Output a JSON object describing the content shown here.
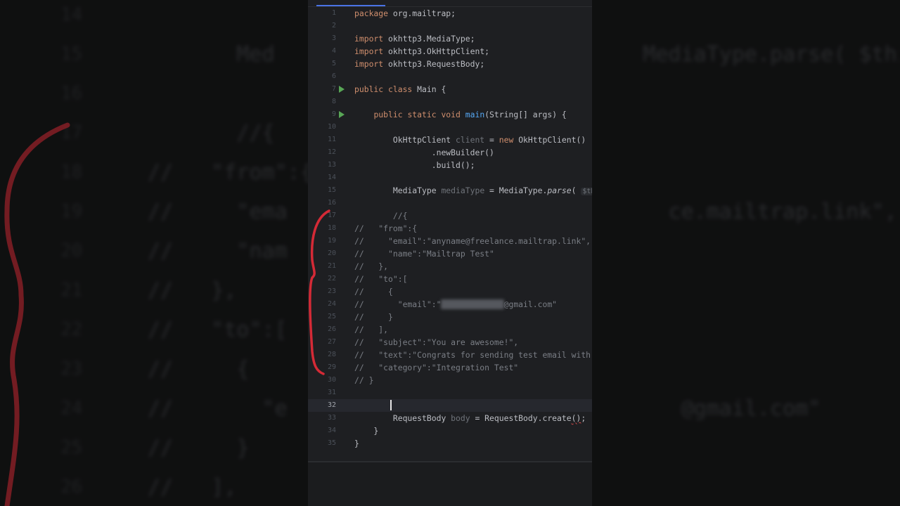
{
  "colors": {
    "background": "#1e1f22",
    "keyword": "#cf8e6d",
    "function": "#56a8f5",
    "comment": "#7a7e85",
    "run_marker": "#58a656",
    "annotation_red": "#d42a36"
  },
  "editor": {
    "lines": [
      {
        "num": "1",
        "segs": [
          {
            "t": "package ",
            "c": "kw"
          },
          {
            "t": "org.mailtrap;"
          }
        ]
      },
      {
        "num": "2",
        "segs": []
      },
      {
        "num": "3",
        "segs": [
          {
            "t": "import ",
            "c": "kw"
          },
          {
            "t": "okhttp3.MediaType;"
          }
        ]
      },
      {
        "num": "4",
        "segs": [
          {
            "t": "import ",
            "c": "kw"
          },
          {
            "t": "okhttp3.OkHttpClient;"
          }
        ]
      },
      {
        "num": "5",
        "segs": [
          {
            "t": "import ",
            "c": "kw"
          },
          {
            "t": "okhttp3.RequestBody;"
          }
        ]
      },
      {
        "num": "6",
        "segs": []
      },
      {
        "num": "7",
        "run": true,
        "segs": [
          {
            "t": "public class ",
            "c": "kw"
          },
          {
            "t": "Main {"
          }
        ]
      },
      {
        "num": "8",
        "segs": []
      },
      {
        "num": "9",
        "run": true,
        "segs": [
          {
            "t": "    "
          },
          {
            "t": "public static void ",
            "c": "kw"
          },
          {
            "t": "main",
            "c": "fn"
          },
          {
            "t": "(String[] args) {"
          }
        ]
      },
      {
        "num": "10",
        "segs": []
      },
      {
        "num": "11",
        "segs": [
          {
            "t": "        OkHttpClient "
          },
          {
            "t": "client",
            "c": "hint"
          },
          {
            "t": " = "
          },
          {
            "t": "new ",
            "c": "kw"
          },
          {
            "t": "OkHttpClient()"
          }
        ]
      },
      {
        "num": "12",
        "segs": [
          {
            "t": "                .newBuilder()"
          }
        ]
      },
      {
        "num": "13",
        "segs": [
          {
            "t": "                .build();"
          }
        ]
      },
      {
        "num": "14",
        "segs": []
      },
      {
        "num": "15",
        "segs": [
          {
            "t": "        MediaType "
          },
          {
            "t": "mediaType",
            "c": "hint"
          },
          {
            "t": " = MediaType."
          },
          {
            "t": "parse",
            "c": "it"
          },
          {
            "t": "( "
          },
          {
            "t": "$this$t",
            "c": "inlay"
          }
        ]
      },
      {
        "num": "16",
        "segs": []
      },
      {
        "num": "17",
        "segs": [
          {
            "t": "        //{",
            "c": "cmt"
          }
        ]
      },
      {
        "num": "18",
        "segs": [
          {
            "t": "//   \"from\":{",
            "c": "cmt"
          }
        ]
      },
      {
        "num": "19",
        "segs": [
          {
            "t": "//     \"email\":\"anyname@freelance.mailtrap.link\",",
            "c": "cmt"
          }
        ]
      },
      {
        "num": "20",
        "segs": [
          {
            "t": "//     \"name\":\"Mailtrap Test\"",
            "c": "cmt"
          }
        ]
      },
      {
        "num": "21",
        "segs": [
          {
            "t": "//   },",
            "c": "cmt"
          }
        ]
      },
      {
        "num": "22",
        "segs": [
          {
            "t": "//   \"to\":[",
            "c": "cmt"
          }
        ]
      },
      {
        "num": "23",
        "segs": [
          {
            "t": "//     {",
            "c": "cmt"
          }
        ]
      },
      {
        "num": "24",
        "segs": [
          {
            "t": "//       \"email\":\"",
            "c": "cmt"
          },
          {
            "t": "xxxxxx.xxxxxx",
            "c": "blur"
          },
          {
            "t": "@gmail.com\"",
            "c": "cmt"
          }
        ]
      },
      {
        "num": "25",
        "segs": [
          {
            "t": "//     }",
            "c": "cmt"
          }
        ]
      },
      {
        "num": "26",
        "segs": [
          {
            "t": "//   ],",
            "c": "cmt"
          }
        ]
      },
      {
        "num": "27",
        "segs": [
          {
            "t": "//   \"subject\":\"You are awesome!\",",
            "c": "cmt"
          }
        ]
      },
      {
        "num": "28",
        "segs": [
          {
            "t": "//   \"text\":\"Congrats for sending test email with Ma",
            "c": "cmt"
          }
        ]
      },
      {
        "num": "29",
        "segs": [
          {
            "t": "//   \"category\":\"Integration Test\"",
            "c": "cmt"
          }
        ]
      },
      {
        "num": "30",
        "segs": [
          {
            "t": "// }",
            "c": "cmt"
          }
        ]
      },
      {
        "num": "31",
        "segs": []
      },
      {
        "num": "32",
        "current": true,
        "segs": []
      },
      {
        "num": "33",
        "segs": [
          {
            "t": "        RequestBody "
          },
          {
            "t": "body",
            "c": "hint"
          },
          {
            "t": " = RequestBody.create"
          },
          {
            "t": "()",
            "c": "squiggle"
          },
          {
            "t": ";"
          }
        ]
      },
      {
        "num": "34",
        "segs": [
          {
            "t": "    }"
          }
        ]
      },
      {
        "num": "35",
        "segs": [
          {
            "t": "}"
          }
        ]
      }
    ]
  },
  "background_copy": {
    "lines": [
      {
        "num": "14",
        "text": ""
      },
      {
        "num": "15",
        "text": "       Med                             MediaType.parse( $this$t"
      },
      {
        "num": "16",
        "text": ""
      },
      {
        "num": "17",
        "text": "       //{"
      },
      {
        "num": "18",
        "text": "//   \"from\":{"
      },
      {
        "num": "19",
        "text": "//     \"ema                              ce.mailtrap.link\","
      },
      {
        "num": "20",
        "text": "//     \"nam"
      },
      {
        "num": "21",
        "text": "//   },"
      },
      {
        "num": "22",
        "text": "//   \"to\":["
      },
      {
        "num": "23",
        "text": "//     {"
      },
      {
        "num": "24",
        "text": "//       \"e                               @gmail.com\""
      },
      {
        "num": "25",
        "text": "//     }"
      },
      {
        "num": "26",
        "text": "//   ],"
      }
    ]
  }
}
